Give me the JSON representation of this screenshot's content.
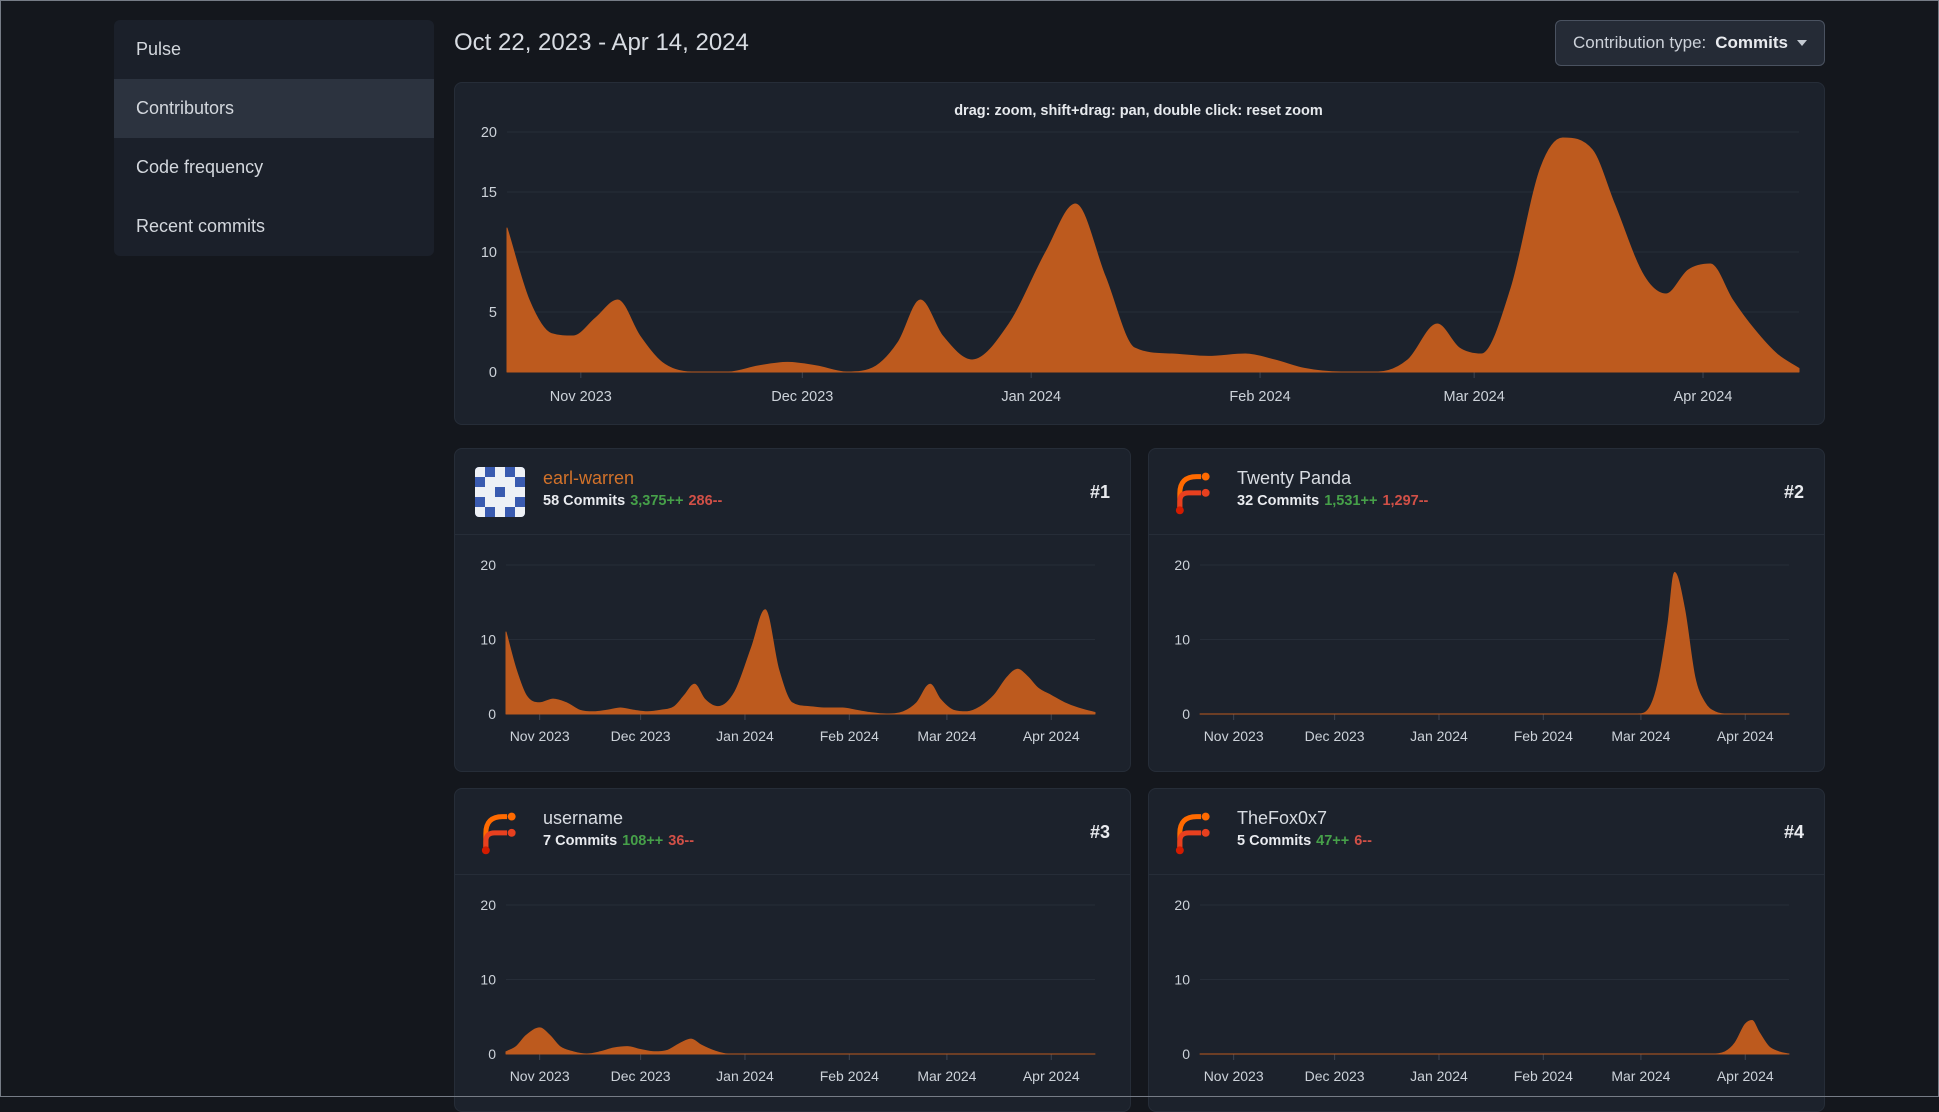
{
  "sidebar": {
    "items": [
      {
        "id": "pulse",
        "label": "Pulse",
        "active": false
      },
      {
        "id": "contributors",
        "label": "Contributors",
        "active": true
      },
      {
        "id": "code-frequency",
        "label": "Code frequency",
        "active": false
      },
      {
        "id": "recent-commits",
        "label": "Recent commits",
        "active": false
      }
    ]
  },
  "header": {
    "date_range": "Oct 22, 2023 - Apr 14, 2024"
  },
  "contribution_type": {
    "label": "Contribution type:",
    "value": "Commits"
  },
  "colors": {
    "area": "#bd5a1e",
    "grid": "#262d38",
    "axis": "#3e4552",
    "tick_text": "#ccd2d9",
    "additions": "#46a049",
    "deletions": "#d15047"
  },
  "contributors": [
    {
      "rank": "#1",
      "name": "earl-warren",
      "name_color": "#d2722a",
      "commits": "58 Commits",
      "additions": "3,375++",
      "deletions": "286--"
    },
    {
      "rank": "#2",
      "name": "Twenty Panda",
      "name_color": "#d8dce2",
      "commits": "32 Commits",
      "additions": "1,531++",
      "deletions": "1,297--"
    },
    {
      "rank": "#3",
      "name": "username",
      "name_color": "#d8dce2",
      "commits": "7 Commits",
      "additions": "108++",
      "deletions": "36--"
    },
    {
      "rank": "#4",
      "name": "TheFox0x7",
      "name_color": "#d8dce2",
      "commits": "5 Commits",
      "additions": "47++",
      "deletions": "6--"
    }
  ],
  "chart_data": {
    "type": "area",
    "color": "#bd5a1e",
    "y_max": 20,
    "x_axis": {
      "start": "Oct 22, 2023",
      "end": "Apr 14, 2024",
      "total_days": 175,
      "labels": [
        {
          "label": "Nov 2023",
          "day": 10
        },
        {
          "label": "Dec 2023",
          "day": 40
        },
        {
          "label": "Jan 2024",
          "day": 71
        },
        {
          "label": "Feb 2024",
          "day": 102
        },
        {
          "label": "Mar 2024",
          "day": 131
        },
        {
          "label": "Apr 2024",
          "day": 162
        }
      ]
    },
    "main": {
      "hint": "drag: zoom, shift+drag: pan, double click: reset zoom",
      "y_ticks": [
        0,
        5,
        10,
        15,
        20
      ],
      "points": [
        [
          0,
          12
        ],
        [
          3,
          6
        ],
        [
          6,
          3.2
        ],
        [
          9,
          3
        ],
        [
          12,
          4.5
        ],
        [
          15,
          6
        ],
        [
          18,
          3
        ],
        [
          21,
          0.8
        ],
        [
          25,
          0
        ],
        [
          30,
          0
        ],
        [
          34,
          0.5
        ],
        [
          38,
          0.8
        ],
        [
          42,
          0.5
        ],
        [
          46,
          0
        ],
        [
          50,
          0.5
        ],
        [
          53,
          2.5
        ],
        [
          56,
          6
        ],
        [
          59,
          3
        ],
        [
          63,
          1
        ],
        [
          68,
          4
        ],
        [
          73,
          10
        ],
        [
          77,
          14
        ],
        [
          81,
          8
        ],
        [
          85,
          2
        ],
        [
          90,
          1.5
        ],
        [
          95,
          1.3
        ],
        [
          100,
          1.5
        ],
        [
          104,
          1
        ],
        [
          108,
          0.3
        ],
        [
          113,
          0
        ],
        [
          118,
          0
        ],
        [
          122,
          1
        ],
        [
          126,
          4
        ],
        [
          129,
          2
        ],
        [
          132,
          1.5
        ],
        [
          136,
          7
        ],
        [
          140,
          17
        ],
        [
          143,
          19.5
        ],
        [
          147,
          18.5
        ],
        [
          150,
          14
        ],
        [
          154,
          8
        ],
        [
          157,
          6.5
        ],
        [
          160,
          8.5
        ],
        [
          163,
          9
        ],
        [
          166,
          6
        ],
        [
          169,
          3.5
        ],
        [
          172,
          1.5
        ],
        [
          175,
          0.3
        ]
      ]
    },
    "mini_y_ticks": [
      0,
      10,
      20
    ],
    "minis": [
      {
        "name": "earl-warren",
        "points": [
          [
            0,
            11
          ],
          [
            3,
            6
          ],
          [
            6,
            2.5
          ],
          [
            10,
            1.5
          ],
          [
            14,
            2
          ],
          [
            18,
            1.5
          ],
          [
            22,
            0.5
          ],
          [
            26,
            0.3
          ],
          [
            30,
            0.5
          ],
          [
            34,
            0.8
          ],
          [
            38,
            0.5
          ],
          [
            42,
            0.3
          ],
          [
            46,
            0.5
          ],
          [
            50,
            1
          ],
          [
            53,
            2.5
          ],
          [
            56,
            4
          ],
          [
            59,
            2
          ],
          [
            63,
            1
          ],
          [
            68,
            3
          ],
          [
            73,
            9
          ],
          [
            77,
            14
          ],
          [
            81,
            6
          ],
          [
            85,
            1.5
          ],
          [
            90,
            1
          ],
          [
            95,
            0.8
          ],
          [
            100,
            0.8
          ],
          [
            104,
            0.5
          ],
          [
            108,
            0.2
          ],
          [
            113,
            0
          ],
          [
            118,
            0.3
          ],
          [
            122,
            1.5
          ],
          [
            126,
            4
          ],
          [
            129,
            2
          ],
          [
            133,
            0.5
          ],
          [
            137,
            0.3
          ],
          [
            141,
            1
          ],
          [
            145,
            2.5
          ],
          [
            149,
            5
          ],
          [
            152,
            6
          ],
          [
            155,
            5
          ],
          [
            158,
            3.5
          ],
          [
            162,
            2.5
          ],
          [
            166,
            1.5
          ],
          [
            170,
            0.8
          ],
          [
            175,
            0.2
          ]
        ]
      },
      {
        "name": "Twenty Panda",
        "points": [
          [
            0,
            0
          ],
          [
            20,
            0
          ],
          [
            40,
            0
          ],
          [
            60,
            0
          ],
          [
            80,
            0
          ],
          [
            100,
            0
          ],
          [
            115,
            0
          ],
          [
            125,
            0
          ],
          [
            130,
            0
          ],
          [
            133,
            0.5
          ],
          [
            136,
            4
          ],
          [
            139,
            12
          ],
          [
            141,
            19
          ],
          [
            144,
            14
          ],
          [
            147,
            5
          ],
          [
            150,
            1.5
          ],
          [
            153,
            0.3
          ],
          [
            157,
            0
          ],
          [
            163,
            0
          ],
          [
            169,
            0
          ],
          [
            175,
            0
          ]
        ]
      },
      {
        "name": "username",
        "points": [
          [
            0,
            0.3
          ],
          [
            3,
            1
          ],
          [
            6,
            2.5
          ],
          [
            10,
            3.5
          ],
          [
            13,
            2.5
          ],
          [
            16,
            1
          ],
          [
            20,
            0.3
          ],
          [
            24,
            0
          ],
          [
            28,
            0.3
          ],
          [
            32,
            0.8
          ],
          [
            36,
            1
          ],
          [
            40,
            0.6
          ],
          [
            44,
            0.3
          ],
          [
            48,
            0.5
          ],
          [
            52,
            1.5
          ],
          [
            55,
            2
          ],
          [
            58,
            1.2
          ],
          [
            62,
            0.4
          ],
          [
            66,
            0
          ],
          [
            75,
            0
          ],
          [
            90,
            0
          ],
          [
            110,
            0
          ],
          [
            130,
            0
          ],
          [
            150,
            0
          ],
          [
            165,
            0
          ],
          [
            175,
            0
          ]
        ]
      },
      {
        "name": "TheFox0x7",
        "points": [
          [
            0,
            0
          ],
          [
            25,
            0
          ],
          [
            50,
            0
          ],
          [
            75,
            0
          ],
          [
            100,
            0
          ],
          [
            125,
            0
          ],
          [
            145,
            0
          ],
          [
            152,
            0
          ],
          [
            156,
            0.3
          ],
          [
            159,
            1.5
          ],
          [
            162,
            4
          ],
          [
            164,
            4.5
          ],
          [
            166,
            3
          ],
          [
            169,
            1
          ],
          [
            172,
            0.3
          ],
          [
            175,
            0
          ]
        ]
      }
    ]
  }
}
